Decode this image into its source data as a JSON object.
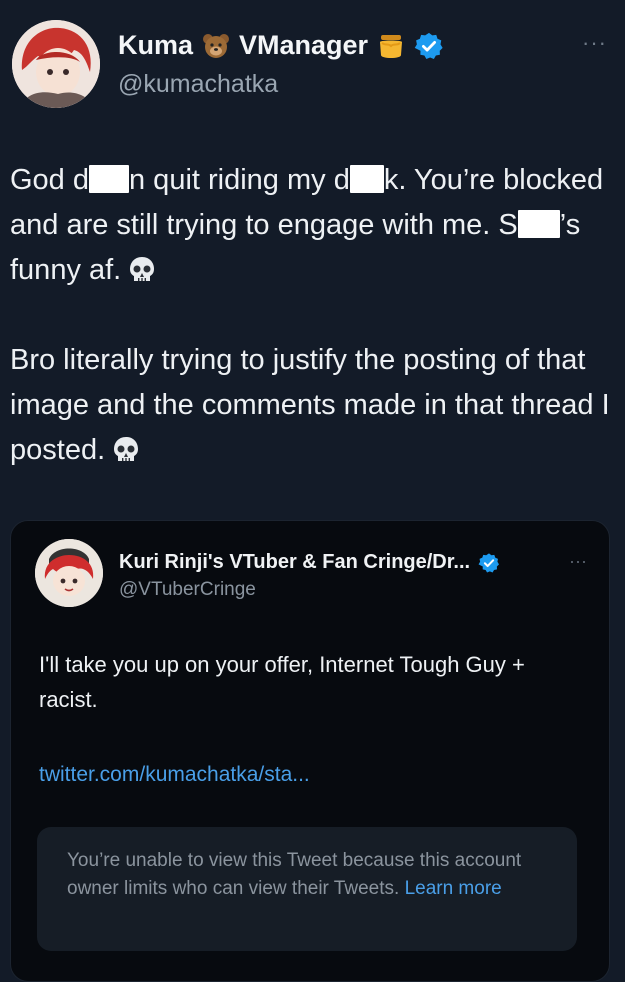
{
  "tweet": {
    "display_name_part1": "Kuma",
    "display_name_part2": "VManager",
    "name_emoji_1": "bear-face-icon",
    "name_emoji_2": "honey-pot-icon",
    "handle": "@kumachatka",
    "more": "···",
    "para1": {
      "t1": "God d",
      "t2": "n quit riding my d",
      "t3": "k. You’re blocked and are still trying to engage with me. S",
      "t4": "’s funny af."
    },
    "para2": "Bro literally trying to justify the posting of that image and the comments made in that thread I posted."
  },
  "quoted": {
    "display_name": "Kuri Rinji's VTuber & Fan Cringe/Dr...",
    "handle": "@VTuberCringe",
    "more": "···",
    "text": "I'll take you up on your offer, Internet Tough Guy + racist.",
    "link": "twitter.com/kumachatka/sta...",
    "notice_text": "You’re unable to view this Tweet because this account owner limits who can view their Tweets.",
    "notice_link": "Learn more"
  },
  "colors": {
    "background": "#131b28",
    "quote_background": "#070a0f",
    "link": "#4a9fe8",
    "verified": "#1d9bf0",
    "muted": "#9aa6b2"
  }
}
